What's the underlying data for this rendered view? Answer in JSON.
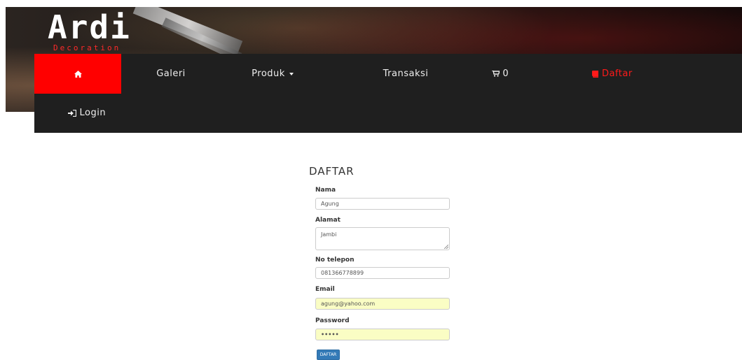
{
  "brand": {
    "logo_text": "Ardi",
    "logo_subtext": "Decoration"
  },
  "nav": {
    "home_icon": "home-icon",
    "galeri": "Galeri",
    "produk": "Produk",
    "transaksi": "Transaksi",
    "cart_count": "0",
    "daftar": "Daftar",
    "login": "Login"
  },
  "form": {
    "title": "DAFTAR",
    "fields": [
      {
        "label": "Nama",
        "value": "Agung",
        "type": "text"
      },
      {
        "label": "Alamat",
        "value": "Jambi",
        "type": "textarea"
      },
      {
        "label": "No telepon",
        "value": "081366778899",
        "type": "text"
      },
      {
        "label": "Email",
        "value": "agung@yahoo.com",
        "type": "email"
      },
      {
        "label": "Password",
        "value": "•••••",
        "type": "password"
      }
    ],
    "submit_label": "DAFTAR"
  },
  "colors": {
    "accent": "#ff0000",
    "navbar": "#1f1f1f",
    "button": "#337ab7",
    "autofill": "#fafdc4"
  }
}
